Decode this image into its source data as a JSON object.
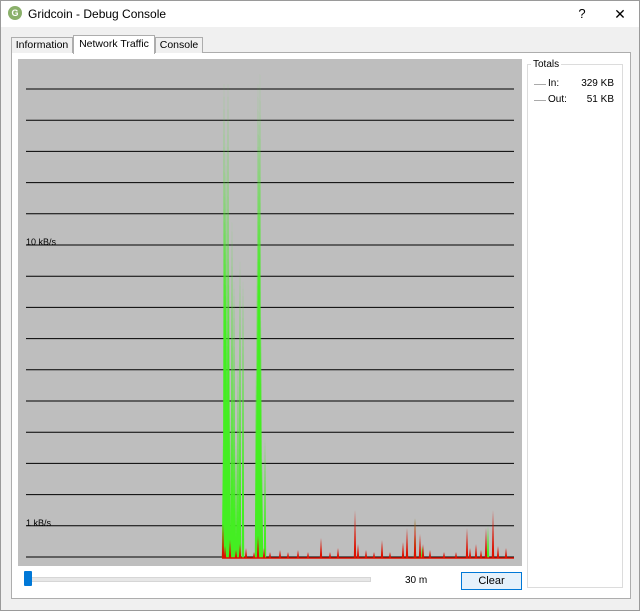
{
  "window": {
    "title": "Gridcoin - Debug Console",
    "help_label": "?",
    "close_label": "✕",
    "app_icon_glyph": "G"
  },
  "tabs": [
    {
      "label": "Information",
      "active": false
    },
    {
      "label": "Network Traffic",
      "active": true
    },
    {
      "label": "Console",
      "active": false
    }
  ],
  "graph": {
    "y_labels": [
      "10 kB/s",
      "1 kB/s"
    ],
    "background": "#bebebe",
    "in_color": "#44ee22",
    "out_color": "#dd1100"
  },
  "totals": {
    "title": "Totals",
    "in_label": "In:",
    "in_value": "329 KB",
    "out_label": "Out:",
    "out_value": "51 KB"
  },
  "controls": {
    "slider_value": 0,
    "duration_label": "30 m",
    "clear_label": "Clear"
  },
  "colors": {
    "accent": "#0078d7",
    "button_bg": "#e5f1fb"
  }
}
